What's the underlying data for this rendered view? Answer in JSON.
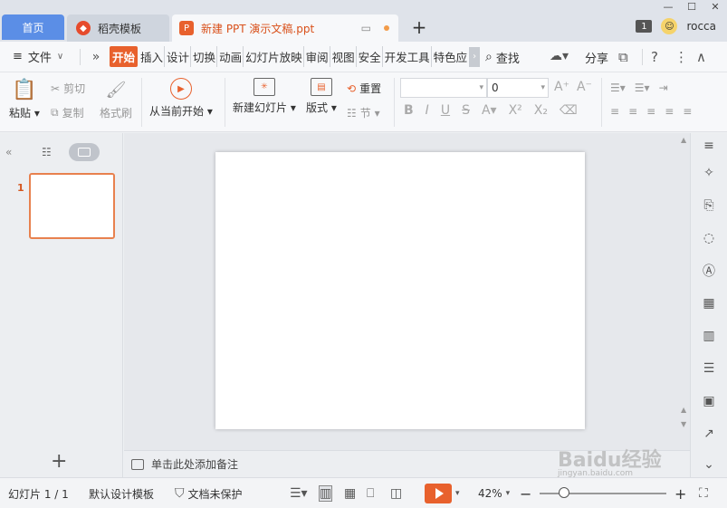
{
  "tabs": {
    "home": "首页",
    "template": "稻壳模板",
    "document": "新建 PPT 演示文稿.ppt",
    "add": "+"
  },
  "window": {
    "minimize": "—",
    "maximize": "☐",
    "close": "✕",
    "notification_count": "1",
    "user_name": "rocca"
  },
  "menu": {
    "file": "文件",
    "collapse": "»",
    "tabs": [
      "开始",
      "插入",
      "设计",
      "切换",
      "动画",
      "幻灯片放映",
      "审阅",
      "视图",
      "安全",
      "开发工具",
      "特色应"
    ],
    "active_tab": "开始",
    "search": "查找",
    "share": "分享",
    "help": "?"
  },
  "ribbon": {
    "paste": "粘贴",
    "cut": "剪切",
    "copy": "复制",
    "format_painter": "格式刷",
    "from_current": "从当前开始",
    "new_slide": "新建幻灯片",
    "layout": "版式",
    "reset": "重置",
    "section": "节",
    "font_name": "",
    "font_size": "0"
  },
  "left_pane": {
    "slide_number": "1",
    "add": "+"
  },
  "notes": {
    "placeholder": "单击此处添加备注"
  },
  "status": {
    "slide_counter": "幻灯片 1 / 1",
    "template": "默认设计模板",
    "protection": "文档未保护",
    "zoom": "42%",
    "zoom_level_percent": 42
  },
  "watermark": {
    "brand": "Baidu经验",
    "url": "jingyan.baidu.com"
  },
  "colors": {
    "accent": "#e8612d",
    "home_tab": "#5b8ee6",
    "selection": "#e8814e"
  }
}
